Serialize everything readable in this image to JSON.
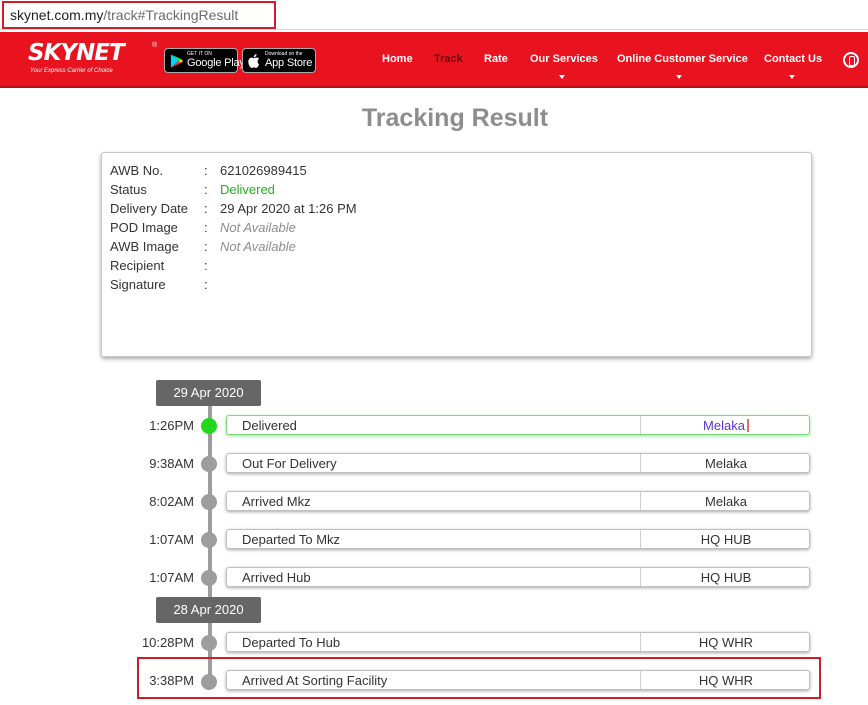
{
  "browser": {
    "url_host": "skynet.com.my",
    "url_path": "/track#TrackingResult"
  },
  "header": {
    "logo_text": "SKYNET",
    "logo_tagline": "Your Express Carrier of Choice",
    "google_play_small": "GET IT ON",
    "google_play_label": "Google Play",
    "app_store_small": "Download on the",
    "app_store_label": "App Store",
    "nav": {
      "home": "Home",
      "track": "Track",
      "rate": "Rate",
      "our_services": "Our Services",
      "online_customer_service": "Online Customer Service",
      "contact_us": "Contact Us"
    },
    "language_icon": "language-icon"
  },
  "page": {
    "title": "Tracking Result"
  },
  "details": {
    "awb_no_label": "AWB No.",
    "awb_no": "621026989415",
    "status_label": "Status",
    "status": "Delivered",
    "delivery_date_label": "Delivery Date",
    "delivery_date": "29 Apr 2020 at 1:26 PM",
    "pod_image_label": "POD Image",
    "pod_image": "Not Available",
    "awb_image_label": "AWB Image",
    "awb_image": "Not Available",
    "recipient_label": "Recipient",
    "signature_label": "Signature",
    "colon": ":"
  },
  "timeline": {
    "dates": [
      "29 Apr 2020",
      "28 Apr 2020"
    ],
    "events": [
      {
        "time": "1:26PM",
        "status": "Delivered",
        "location": "Melaka"
      },
      {
        "time": "9:38AM",
        "status": "Out For Delivery",
        "location": "Melaka"
      },
      {
        "time": "8:02AM",
        "status": "Arrived Mkz",
        "location": "Melaka"
      },
      {
        "time": "1:07AM",
        "status": "Departed To Mkz",
        "location": "HQ HUB"
      },
      {
        "time": "1:07AM",
        "status": "Arrived Hub",
        "location": "HQ HUB"
      },
      {
        "time": "10:28PM",
        "status": "Departed To Hub",
        "location": "HQ WHR"
      },
      {
        "time": "3:38PM",
        "status": "Arrived At Sorting Facility",
        "location": "HQ WHR"
      }
    ]
  },
  "colors": {
    "brand_red": "#e8131f",
    "delivered_green": "#21d81c",
    "highlight_red": "#cc1f2b"
  }
}
